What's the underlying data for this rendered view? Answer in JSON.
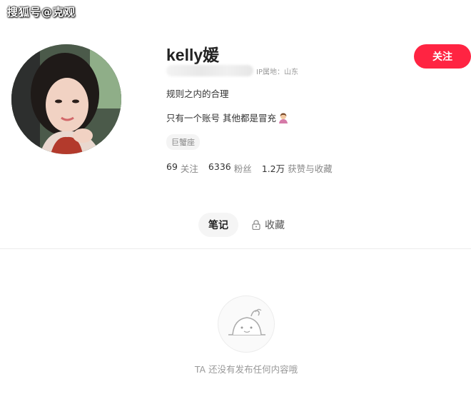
{
  "watermark": "搜狐号@克观",
  "profile": {
    "nickname": "kelly媛",
    "ip_location": "IP属地：山东",
    "bio_line1": "规则之内的合理",
    "bio_line2": "只有一个账号 其他都是冒充",
    "tag": "巨蟹座",
    "stats": [
      {
        "num": "69",
        "label": "关注"
      },
      {
        "num": "6336",
        "label": "粉丝"
      },
      {
        "num": "1.2万",
        "label": "获赞与收藏"
      }
    ],
    "follow_label": "关注"
  },
  "tabs": [
    {
      "label": "笔记",
      "active": true
    },
    {
      "label": "收藏",
      "active": false,
      "icon": "lock-icon"
    }
  ],
  "empty_state": {
    "icon": "empty-notes-icon",
    "text": "TA 还没有发布任何内容哦"
  },
  "colors": {
    "accent": "#ff2442",
    "muted": "#999999"
  }
}
